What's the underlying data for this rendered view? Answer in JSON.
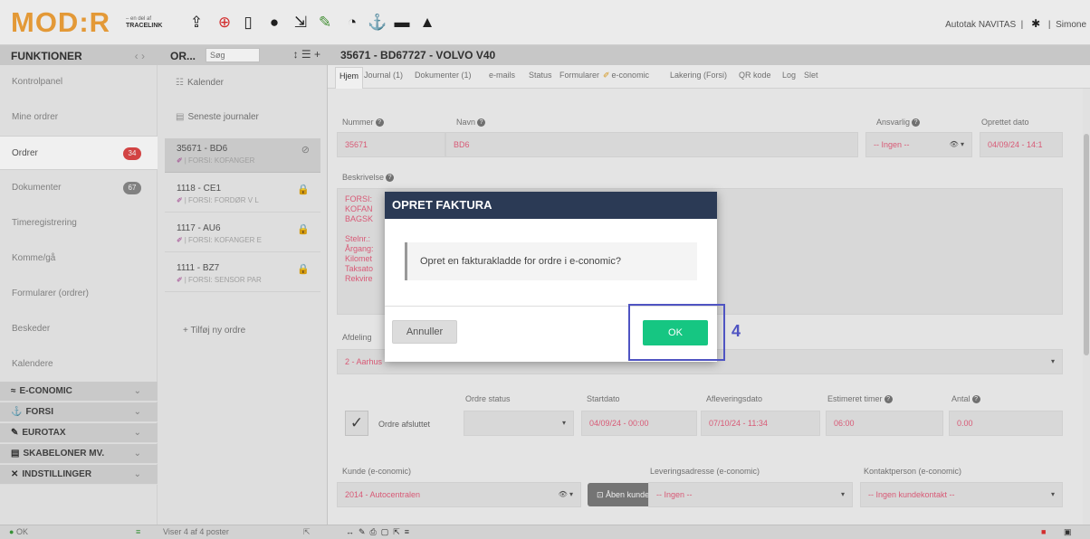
{
  "brand": {
    "logo_text": "MOD:R",
    "logo_small_top": "– en del af",
    "logo_small_bottom": "TRACELINK"
  },
  "toolbar": {
    "icons": [
      {
        "name": "upload-icon",
        "glyph": "⇪",
        "color": "#222",
        "dot": false
      },
      {
        "name": "lifebuoy-icon",
        "glyph": "⊕",
        "color": "#e03030",
        "dot": false
      },
      {
        "name": "tablet-icon",
        "glyph": "▯",
        "color": "#222",
        "dot": false
      },
      {
        "name": "chat-icon",
        "glyph": "●",
        "color": "#222",
        "dot": false
      },
      {
        "name": "logout-icon",
        "glyph": "⇲",
        "color": "#222",
        "dot": true
      },
      {
        "name": "tools-icon",
        "glyph": "✎",
        "color": "#4a9a3a",
        "dot": true
      },
      {
        "name": "stopwatch-icon",
        "glyph": "◔",
        "color": "#222",
        "dot": true
      },
      {
        "name": "anchor-icon",
        "glyph": "⚓",
        "color": "#222",
        "dot": false
      },
      {
        "name": "card-icon",
        "glyph": "▬",
        "color": "#222",
        "dot": false
      },
      {
        "name": "warning-icon",
        "glyph": "▲",
        "color": "#222",
        "dot": false
      }
    ],
    "company": "Autotak NAVITAS",
    "user": "Simone"
  },
  "sidebar": {
    "header": "FUNKTIONER",
    "arrows": "‹  ›",
    "items": [
      {
        "label": "Kontrolpanel",
        "badge": "",
        "badge_type": ""
      },
      {
        "label": "Mine ordrer",
        "badge": "",
        "badge_type": ""
      },
      {
        "label": "Ordrer",
        "badge": "34",
        "badge_type": "red"
      },
      {
        "label": "Dokumenter",
        "badge": "67",
        "badge_type": "gray"
      },
      {
        "label": "Timeregistrering",
        "badge": "",
        "badge_type": ""
      },
      {
        "label": "Komme/gå",
        "badge": "",
        "badge_type": ""
      },
      {
        "label": "Formularer (ordrer)",
        "badge": "",
        "badge_type": ""
      },
      {
        "label": "Beskeder",
        "badge": "",
        "badge_type": ""
      },
      {
        "label": "Kalendere",
        "badge": "",
        "badge_type": ""
      }
    ],
    "groups": [
      {
        "label": "E-CONOMIC",
        "icon": "≈",
        "name": "economic-icon"
      },
      {
        "label": "FORSI",
        "icon": "⚓",
        "name": "forsi-icon"
      },
      {
        "label": "EUROTAX",
        "icon": "✎",
        "name": "eurotax-icon"
      },
      {
        "label": "SKABELONER MV.",
        "icon": "▤",
        "name": "template-icon"
      },
      {
        "label": "INDSTILLINGER",
        "icon": "✕",
        "name": "settings-icon"
      }
    ]
  },
  "orders": {
    "header": "OR...",
    "search_placeholder": "Søg",
    "tools": "↕ ☰ +",
    "links": [
      {
        "label": "Kalender",
        "icon": "☷"
      },
      {
        "label": "Seneste journaler",
        "icon": "▤"
      }
    ],
    "items": [
      {
        "title": "35671 - BD6",
        "sub": "| FORSI: KOFANGER",
        "status": "⊘"
      },
      {
        "title": "1118 - CE1",
        "sub": "| FORSI: FORDØR V L",
        "status": "🔒"
      },
      {
        "title": "1117 - AU6",
        "sub": "| FORSI: KOFANGER E",
        "status": "🔒"
      },
      {
        "title": "1111 - BZ7",
        "sub": "| FORSI: SENSOR PAR",
        "status": "🔒"
      }
    ],
    "add_label": "+ Tilføj ny ordre"
  },
  "main": {
    "title": "35671 - BD67727 - VOLVO V40",
    "tabs": [
      "Hjem",
      "Journal (1)",
      "Dokumenter (1)",
      "e-mails",
      "Status",
      "Formularer",
      "e-conomic",
      "Lakering (Forsi)",
      "QR kode",
      "Log",
      "Slet"
    ],
    "labels": {
      "number": "Nummer",
      "name": "Navn",
      "responsible": "Ansvarlig",
      "created": "Oprettet dato",
      "description": "Beskrivelse",
      "department": "Afdeling",
      "order_status": "Ordre status",
      "start": "Startdato",
      "delivery": "Afleveringsdato",
      "est_hours": "Estimeret timer",
      "amount": "Antal",
      "customer": "Kunde (e-conomic)",
      "delivery_addr": "Leveringsadresse (e-conomic)",
      "contact": "Kontaktperson (e-conomic)"
    },
    "values": {
      "number": "35671",
      "name": "BD6",
      "responsible": "-- Ingen --",
      "created": "04/09/24 - 14:1",
      "department": "2 - Aarhus",
      "completed_label": "Ordre afsluttet",
      "order_status": "",
      "start": "04/09/24 - 00:00",
      "delivery": "07/10/24 - 11:34",
      "est_hours": "06:00",
      "amount": "0.00",
      "customer": "2014 - Autocentralen",
      "open_customer": "Åben kunde",
      "delivery_addr": "-- Ingen --",
      "contact": "-- Ingen kundekontakt --"
    },
    "desc_lines": [
      "FORSI:",
      "KOFAN",
      "BAGSK",
      "",
      "Stelnr.:",
      "Årgang:",
      "Kilomet",
      "Taksato",
      "Rekvire"
    ]
  },
  "statusbar": {
    "ok": "OK",
    "count": "Viser 4 af 4 poster"
  },
  "modal": {
    "title": "OPRET FAKTURA",
    "message": "Opret en fakturakladde for ordre i e-conomic?",
    "cancel": "Annuller",
    "ok": "OK"
  },
  "annotation": {
    "step": "4",
    "color": "#4f54c2"
  }
}
